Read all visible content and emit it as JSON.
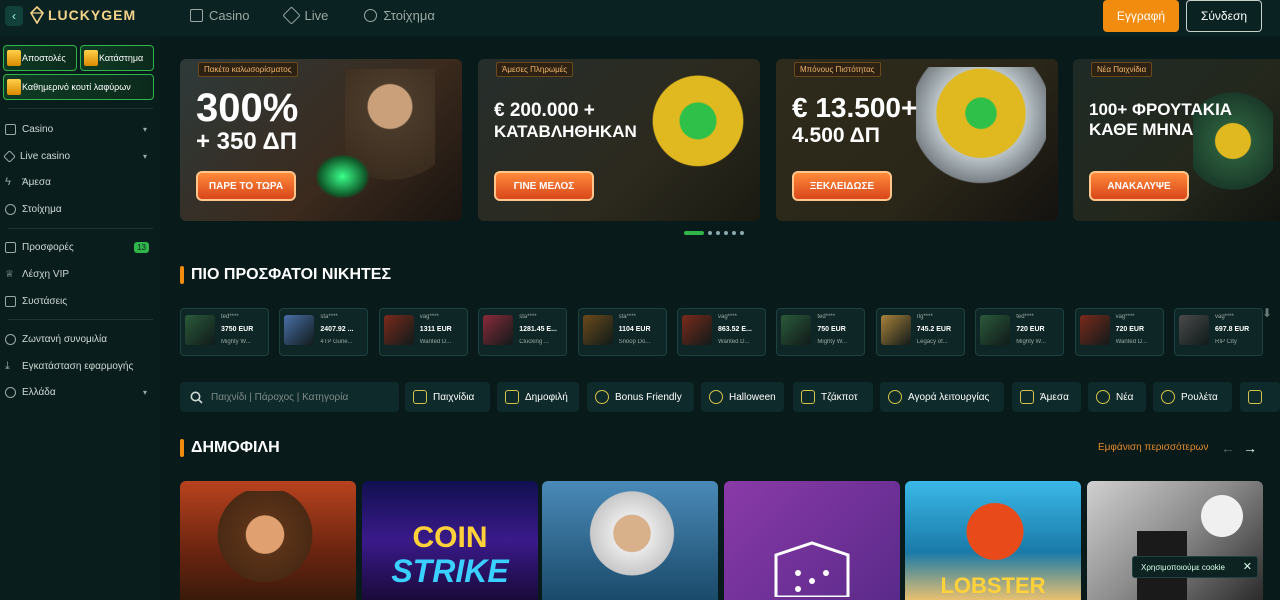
{
  "brand": {
    "name": "LUCKYGEM"
  },
  "topnav": [
    {
      "label": "Casino",
      "icon": "casino-icon"
    },
    {
      "label": "Live",
      "icon": "live-icon"
    },
    {
      "label": "Στοίχημα",
      "icon": "sports-icon"
    }
  ],
  "auth": {
    "register": "Εγγραφή",
    "login": "Σύνδεση"
  },
  "sidebar": {
    "promos": [
      "Αποστολές",
      "Κατάστημα",
      "Καθημερινό κουτί λαφύρων"
    ],
    "items": [
      {
        "label": "Casino",
        "chevron": "▾",
        "icon": "casino-icon"
      },
      {
        "label": "Live casino",
        "chevron": "▾",
        "icon": "live-icon"
      },
      {
        "label": "Άμεσα",
        "icon": "lightning-icon"
      },
      {
        "label": "Στοίχημα",
        "icon": "sports-icon"
      },
      {
        "label": "Προσφορές",
        "badge": "13",
        "icon": "gift-icon"
      },
      {
        "label": "Λέσχη VIP",
        "icon": "crown-icon"
      },
      {
        "label": "Συστάσεις",
        "icon": "megaphone-icon"
      },
      {
        "label": "Ζωντανή συνομιλία",
        "icon": "chat-icon"
      },
      {
        "label": "Εγκατάσταση εφαρμογής",
        "icon": "download-icon"
      },
      {
        "label": "Ελλάδα",
        "chevron": "▾",
        "icon": "globe-icon"
      }
    ]
  },
  "banners": [
    {
      "tag": "Πακέτο καλωσορίσματος",
      "line1": "300%",
      "line2": "+ 350 ΔΠ",
      "button": "ΠΑΡΕ ΤΟ ΤΩΡΑ"
    },
    {
      "tag": "Άμεσες Πληρωμές",
      "line1": "€ 200.000 +",
      "line2": "ΚΑΤΑΒΛΗΘΗΚΑΝ",
      "button": "ΓΙΝΕ ΜΕΛΟΣ"
    },
    {
      "tag": "Μπόνους Πιστότητας",
      "line1": "€ 13.500+",
      "line2": "4.500 ΔΠ",
      "button": "ΞΕΚΛΕΙΔΩΣΕ"
    },
    {
      "tag": "Νέα Παιχνίδια",
      "line1": "100+ ΦΡΟΥΤΑΚΙΑ",
      "line2": "ΚΑΘΕ ΜΗΝΑ",
      "button": "ΑΝΑΚΑΛΥΨΕ"
    }
  ],
  "winners_title": "ΠΙΟ ΠΡΟΣΦΑΤΟΙ ΝΙΚΗΤΕΣ",
  "winners": [
    {
      "user": "ted****",
      "amount": "3750 EUR",
      "game": "Mighty W...",
      "color": "#2b5a3a"
    },
    {
      "user": "sta****",
      "amount": "2407.92 ...",
      "game": "4TP Gune...",
      "color": "#4a6fa8"
    },
    {
      "user": "vag****",
      "amount": "1311 EUR",
      "game": "Wanted D...",
      "color": "#7a2a1a"
    },
    {
      "user": "sta****",
      "amount": "1281.45 E...",
      "game": "Clucking ...",
      "color": "#8a2a3a"
    },
    {
      "user": "sta****",
      "amount": "1104 EUR",
      "game": "Snoop Do...",
      "color": "#6a4a1a"
    },
    {
      "user": "vag****",
      "amount": "863.52 E...",
      "game": "Wanted D...",
      "color": "#7a2a1a"
    },
    {
      "user": "ted****",
      "amount": "750 EUR",
      "game": "Mighty W...",
      "color": "#2b5a3a"
    },
    {
      "user": "rig****",
      "amount": "745.2 EUR",
      "game": "Legacy of...",
      "color": "#a8823a"
    },
    {
      "user": "ted****",
      "amount": "720 EUR",
      "game": "Mighty W...",
      "color": "#2b5a3a"
    },
    {
      "user": "vag****",
      "amount": "720 EUR",
      "game": "Wanted D...",
      "color": "#7a2a1a"
    },
    {
      "user": "vag****",
      "amount": "697.8 EUR",
      "game": "RIP City",
      "color": "#4a4a4a"
    }
  ],
  "search": {
    "placeholder": "Παιχνίδι | Πάροχος | Κατηγορία"
  },
  "chips": [
    {
      "label": "Παιχνίδια",
      "icon": "dice-icon"
    },
    {
      "label": "Δημοφιλή",
      "icon": "trophy-icon"
    },
    {
      "label": "Bonus Friendly",
      "icon": "smile-icon"
    },
    {
      "label": "Halloween",
      "icon": "pumpkin-icon"
    },
    {
      "label": "Τζάκποτ",
      "icon": "jackpot-icon"
    },
    {
      "label": "Αγορά λειτουργίας",
      "icon": "coins-icon"
    },
    {
      "label": "Άμεσα",
      "icon": "lightning-icon"
    },
    {
      "label": "Νέα",
      "icon": "star-icon"
    },
    {
      "label": "Ρουλέτα",
      "icon": "roulette-icon"
    }
  ],
  "popular_title": "ΔΗΜΟΦΙΛΗ",
  "show_more": "Εμφάνιση περισσότερων",
  "games": [
    {
      "label": "",
      "name": "cowboy-slot"
    },
    {
      "label": "COIN",
      "label2": "STRIKE",
      "name": "coin-strike"
    },
    {
      "label": "",
      "name": "poseidon-slot"
    },
    {
      "label": "",
      "name": "dice-game"
    },
    {
      "label": "LOBSTER",
      "name": "lobster-slot"
    },
    {
      "label": "",
      "name": "rip-city"
    }
  ],
  "cookie": {
    "text": "Χρησιμοποιούμε cookie"
  }
}
